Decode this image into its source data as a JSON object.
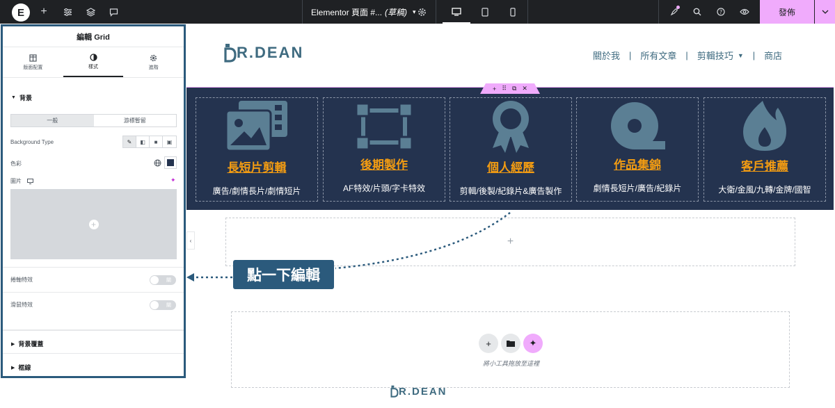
{
  "topbar": {
    "doc_title": "Elementor 頁面 #...",
    "doc_status": "(草稿)",
    "publish_label": "發佈"
  },
  "panel": {
    "title": "編輯 Grid",
    "tabs": [
      {
        "label": "版面配置",
        "icon": "layout-icon"
      },
      {
        "label": "樣式",
        "icon": "contrast-icon"
      },
      {
        "label": "進階",
        "icon": "gear-icon"
      }
    ],
    "active_tab": 1,
    "background_section": "背景",
    "state_tabs": [
      "一般",
      "游標暫留"
    ],
    "background_type_label": "Background Type",
    "color_label": "色彩",
    "image_label": "圖片",
    "scroll_effect_label": "捲軸特效",
    "mouse_effect_label": "滑鼠特效",
    "toggle_off": "關",
    "overlay_section": "背景覆蓋",
    "border_section": "框線"
  },
  "site": {
    "logo": "R.DEAN",
    "nav": [
      "關於我",
      "所有文章",
      "剪輯技巧",
      "商店"
    ],
    "cards": [
      {
        "title": "長短片剪輯",
        "sub": "廣告/劇情長片/劇情短片"
      },
      {
        "title": "後期製作",
        "sub": "AF特效/片頭/字卡特效"
      },
      {
        "title": "個人經歷",
        "sub": "剪輯/後製/紀錄片&廣告製作"
      },
      {
        "title": "作品集錦",
        "sub": "劇情長短片/廣告/紀錄片"
      },
      {
        "title": "客戶推薦",
        "sub": "大衛/金風/九轉/金牌/國智"
      }
    ],
    "drop_text": "將小工具拖放至這裡",
    "footer_logo": "R.DEAN"
  },
  "callout": "點一下編輯",
  "colors": {
    "accent": "#f0abfc",
    "panel_border": "#2b5a7c",
    "section_bg": "#24334f",
    "card_title": "#f39c12",
    "logo": "#3f6b80"
  }
}
